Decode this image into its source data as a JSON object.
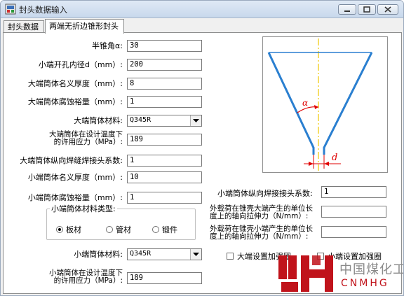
{
  "window": {
    "title": "封头数据输入"
  },
  "tabs": [
    {
      "label": "封头数据"
    },
    {
      "label": "两端无折边锥形封头"
    }
  ],
  "form": {
    "half_cone_angle": {
      "label": "半锥角α:",
      "value": "30"
    },
    "small_end_bore": {
      "label": "小端开孔内径d（mm）:",
      "value": "200"
    },
    "large_shell_thickness": {
      "label": "大端筒体名义厚度（mm）:",
      "value": "8"
    },
    "large_corrosion": {
      "label": "大端筒体腐蚀裕量（mm）:",
      "value": "1"
    },
    "large_material": {
      "label": "大端筒体材料:",
      "value": "Q345R"
    },
    "large_allowable_stress": {
      "label": "大端筒体在设计温度下的许用应力（MPa）:",
      "value": "189"
    },
    "large_weld_coef": {
      "label": "大端筒体纵向焊缝焊接头系数:",
      "value": "1"
    },
    "small_shell_thickness": {
      "label": "小端筒体名义厚度（mm）:",
      "value": "10"
    },
    "small_corrosion": {
      "label": "小端筒体腐蚀裕量（mm）:",
      "value": "1"
    },
    "small_material_type": {
      "title": "小端筒体材料类型:",
      "options": [
        "板材",
        "管材",
        "锻件"
      ],
      "selected": "板材"
    },
    "small_material": {
      "label": "小端筒体材料:",
      "value": "Q345R"
    },
    "small_allowable_stress": {
      "label": "小端筒体在设计温度下的许用应力（MPa）:",
      "value": "189"
    },
    "small_weld_coef": {
      "label": "小端筒体纵向焊接接头系数:",
      "value": "1"
    },
    "large_end_load": {
      "label": "外载荷在锥壳大端产生的单位长度上的轴向拉伸力（N/mm）:",
      "value": ""
    },
    "small_end_load": {
      "label": "外载荷在锥壳小端产生的单位长度上的轴向拉伸力（N/mm）:",
      "value": ""
    },
    "large_reinforce": {
      "label": "大端设置加强圈",
      "checked": false
    },
    "small_reinforce": {
      "label": "小端设置加强圈",
      "checked": false
    }
  },
  "diagram": {
    "angle_label": "α",
    "diameter_label": "d"
  },
  "watermark": {
    "cn": "中国煤化工",
    "en": "CNMHG"
  },
  "colors": {
    "cone": "#2a7fd0",
    "axis": "#f0c800",
    "dim": "#e00000",
    "watermark_red": "#c0131b"
  },
  "icons": [
    "app-icon",
    "minimize-icon",
    "maximize-icon",
    "close-icon",
    "dropdown-arrow-icon"
  ]
}
